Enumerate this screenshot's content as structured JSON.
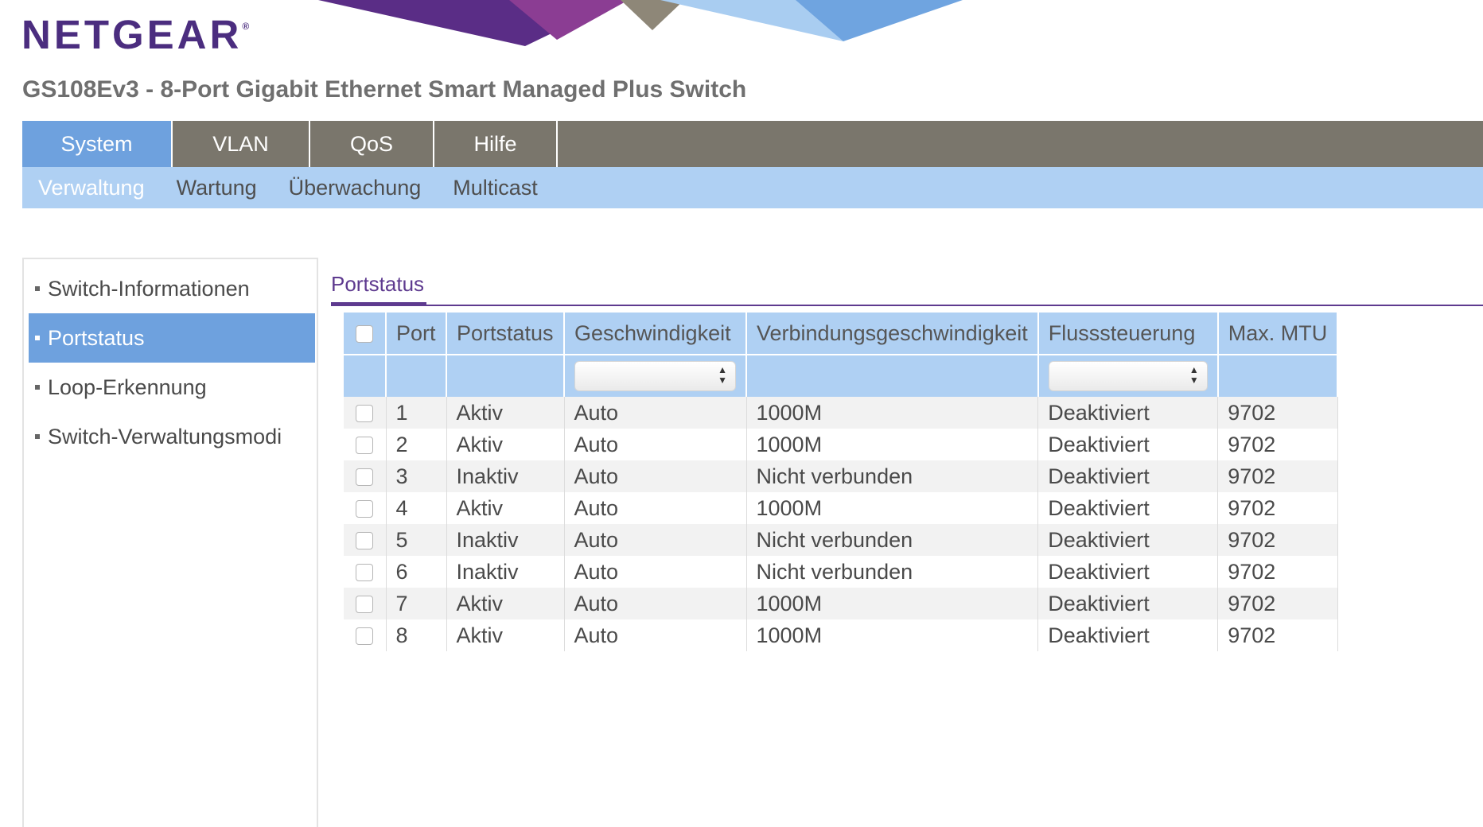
{
  "header": {
    "logo": "NETGEAR",
    "logo_mark": "®",
    "product_title": "GS108Ev3 - 8-Port Gigabit Ethernet Smart Managed Plus Switch"
  },
  "main_nav": {
    "tabs": [
      {
        "label": "System",
        "active": true
      },
      {
        "label": "VLAN",
        "active": false
      },
      {
        "label": "QoS",
        "active": false
      },
      {
        "label": "Hilfe",
        "active": false
      }
    ]
  },
  "sub_nav": {
    "items": [
      {
        "label": "Verwaltung",
        "active": true
      },
      {
        "label": "Wartung",
        "active": false
      },
      {
        "label": "Überwachung",
        "active": false
      },
      {
        "label": "Multicast",
        "active": false
      }
    ]
  },
  "sidebar": {
    "items": [
      {
        "label": "Switch-Informationen",
        "active": false
      },
      {
        "label": "Portstatus",
        "active": true
      },
      {
        "label": "Loop-Erkennung",
        "active": false
      },
      {
        "label": "Switch-Verwaltungsmodi",
        "active": false
      }
    ]
  },
  "content": {
    "section_title": "Portstatus",
    "table": {
      "headers": [
        "Port",
        "Portstatus",
        "Geschwindigkeit",
        "Verbindungsgeschwindigkeit",
        "Flusssteuerung",
        "Max. MTU"
      ],
      "rows": [
        {
          "port": "1",
          "status": "Aktiv",
          "speed": "Auto",
          "link_speed": "1000M",
          "flow_control": "Deaktiviert",
          "mtu": "9702"
        },
        {
          "port": "2",
          "status": "Aktiv",
          "speed": "Auto",
          "link_speed": "1000M",
          "flow_control": "Deaktiviert",
          "mtu": "9702"
        },
        {
          "port": "3",
          "status": "Inaktiv",
          "speed": "Auto",
          "link_speed": "Nicht verbunden",
          "flow_control": "Deaktiviert",
          "mtu": "9702"
        },
        {
          "port": "4",
          "status": "Aktiv",
          "speed": "Auto",
          "link_speed": "1000M",
          "flow_control": "Deaktiviert",
          "mtu": "9702"
        },
        {
          "port": "5",
          "status": "Inaktiv",
          "speed": "Auto",
          "link_speed": "Nicht verbunden",
          "flow_control": "Deaktiviert",
          "mtu": "9702"
        },
        {
          "port": "6",
          "status": "Inaktiv",
          "speed": "Auto",
          "link_speed": "Nicht verbunden",
          "flow_control": "Deaktiviert",
          "mtu": "9702"
        },
        {
          "port": "7",
          "status": "Aktiv",
          "speed": "Auto",
          "link_speed": "1000M",
          "flow_control": "Deaktiviert",
          "mtu": "9702"
        },
        {
          "port": "8",
          "status": "Aktiv",
          "speed": "Auto",
          "link_speed": "1000M",
          "flow_control": "Deaktiviert",
          "mtu": "9702"
        }
      ]
    }
  },
  "colors": {
    "brand_purple": "#4b2d7f",
    "nav_gray": "#7a766c",
    "active_blue": "#6ea1de",
    "light_blue": "#afd0f3"
  }
}
